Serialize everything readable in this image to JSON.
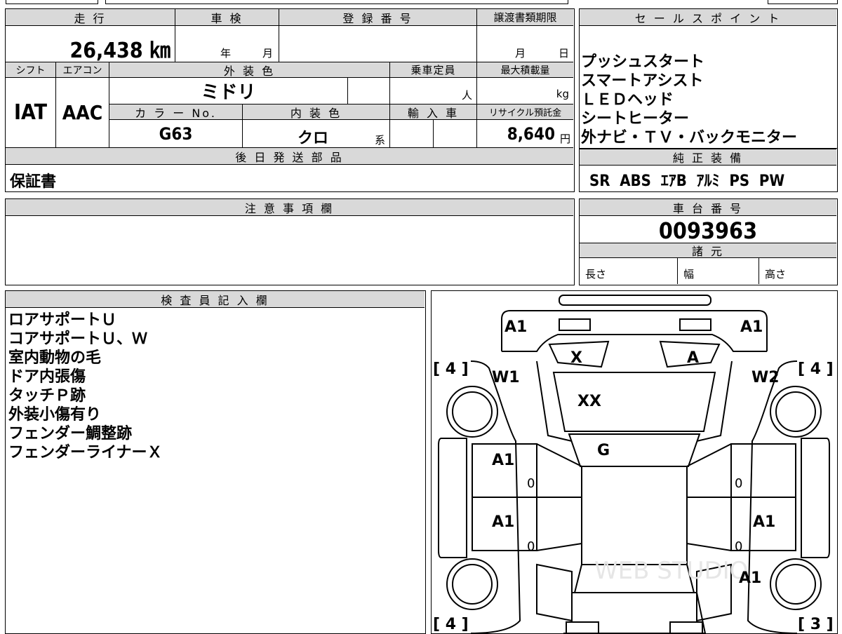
{
  "header_row": {
    "mileage_label": "走 行",
    "inspection_label": "車 検",
    "registration_label": "登 録 番 号",
    "transfer_label": "譲渡書類期限",
    "mileage_value": "26,438 ㎞",
    "inspection_year": "年",
    "inspection_month": "月",
    "transfer_month": "月",
    "transfer_day": "日"
  },
  "row2": {
    "shift_label": "シフト",
    "ac_label": "エアコン",
    "exterior_color_label": "外 装 色",
    "capacity_label": "乗車定員",
    "max_load_label": "最大積載量",
    "shift_value": "IAT",
    "ac_value": "AAC",
    "exterior_color_value": "ミドリ",
    "capacity_unit": "人",
    "max_load_unit": "kg"
  },
  "row3": {
    "color_no_label": "カ ラ ー No.",
    "interior_color_label": "内 装 色",
    "import_label": "輸 入 車",
    "recycle_label": "リサイクル預託金",
    "color_no_value": "G63",
    "interior_color_value": "クロ",
    "interior_suffix": "系",
    "recycle_value": "8,640",
    "recycle_unit": "円"
  },
  "later_parts": {
    "label": "後 日 発 送 部 品",
    "value": "保証書"
  },
  "notes": {
    "label": "注 意 事 項 欄"
  },
  "sales_points": {
    "label": "セ ー ル ス ポ イ ン ト",
    "items": [
      "プッシュスタート",
      "スマートアシスト",
      "ＬＥＤヘッド",
      "シートヒーター",
      "外ナビ・ＴＶ・バックモニター"
    ]
  },
  "genuine_equipment": {
    "label": "純 正 装 備",
    "value": "SR  ABS  ｴｱB  ｱﾙﾐ  PS  PW"
  },
  "chassis": {
    "label": "車 台 番 号",
    "value": "0093963"
  },
  "specs": {
    "label": "諸 元",
    "length": "長さ",
    "width": "幅",
    "height": "高さ"
  },
  "inspector": {
    "label": "検 査 員 記 入 欄",
    "lines": [
      "ロアサポートＵ",
      "コアサポートＵ、Ｗ",
      "室内動物の毛",
      "ドア内張傷",
      "タッチＰ跡",
      "外装小傷有り",
      "フェンダー鯛整跡",
      "フェンダーライナーＸ"
    ]
  },
  "diagram": {
    "front_left": "A1",
    "front_right": "A1",
    "left_top_tire": "[ 4 ]",
    "right_top_tire": "[ 4 ]",
    "left_bottom_tire": "[ 4 ]",
    "right_bottom_tire": "[ 3 ]",
    "fender_left": "W1",
    "fender_right": "W2",
    "light_left": "X",
    "light_right": "A",
    "hood": "XX",
    "windshield": "G",
    "door_fl": "A1",
    "door_rl": "A1",
    "door_rr": "A1",
    "rear_right": "A1",
    "zero_1": "0",
    "zero_2": "0",
    "zero_3": "0",
    "zero_4": "0",
    "watermark": "WEB STUDIO"
  }
}
